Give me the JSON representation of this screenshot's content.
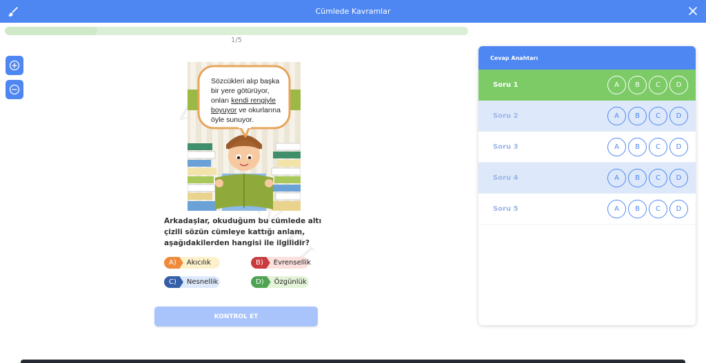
{
  "header": {
    "title": "Cümlede Kavramlar",
    "left_icon": "paintbrush-icon",
    "right_icon": "close-icon",
    "color": "#4e86f2"
  },
  "progress": {
    "counter": "1/5",
    "fraction": 0.2
  },
  "zoom": {
    "in_icon": "zoom-in-icon",
    "out_icon": "zoom-out-icon"
  },
  "watermark": "VITAMIN PI",
  "illustration": {
    "speech_lines": [
      "Sözcükleri alıp başka",
      "bir yere götürüyor,",
      "onları ",
      "kendi rengiyle",
      "boyuyor",
      " ve okurlarına",
      "öyle sunuyor."
    ]
  },
  "question": {
    "text": "Arkadaşlar, okuduğum bu cümlede altı çizili sözün cümleye kattığı anlam, aşağıdakilerden hangisi ile ilgilidir?"
  },
  "options": [
    {
      "letter": "A)",
      "text": "Akıcılık",
      "color": "#ef8a3a"
    },
    {
      "letter": "B)",
      "text": "Evrensellik",
      "color": "#c93b3f"
    },
    {
      "letter": "C)",
      "text": "Nesnellik",
      "color": "#355fa8"
    },
    {
      "letter": "D)",
      "text": "Özgünlük",
      "color": "#4fa352"
    }
  ],
  "check_button": "KONTROL ET",
  "answer_key": {
    "title": "Cevap Anahtarı",
    "rows": [
      {
        "label": "Soru 1",
        "state": "active"
      },
      {
        "label": "Soru 2",
        "state": "alt"
      },
      {
        "label": "Soru 3",
        "state": "white"
      },
      {
        "label": "Soru 4",
        "state": "alt"
      },
      {
        "label": "Soru 5",
        "state": "white"
      }
    ],
    "choices": [
      "A",
      "B",
      "C",
      "D"
    ],
    "active_color": "#7ccb67",
    "alt_color": "#dde9fb"
  }
}
